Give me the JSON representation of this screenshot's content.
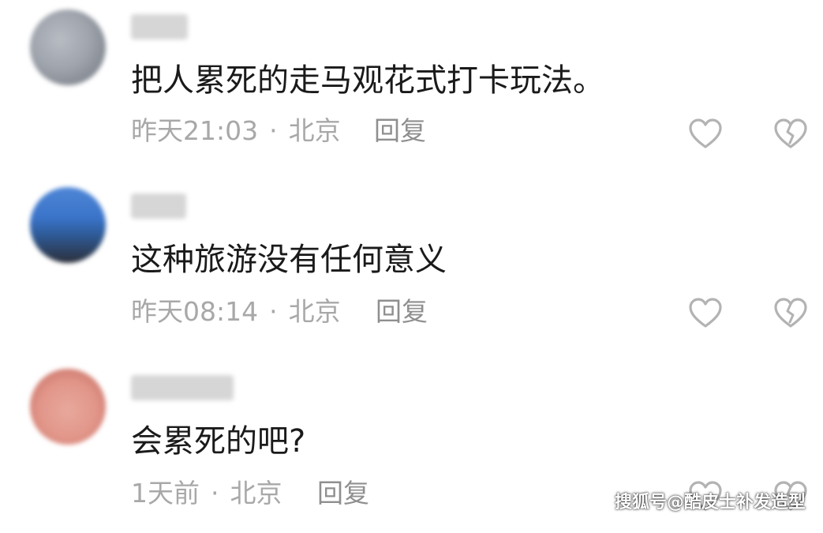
{
  "comments": [
    {
      "text": "把人累死的走马观花式打卡玩法。",
      "time": "昨天21:03",
      "separator": "·",
      "location": "北京",
      "reply_label": "回复",
      "avatar_colors": [
        "#9fa4ad",
        "#6e747c"
      ],
      "like_icon": "heart-outline-icon",
      "dislike_icon": "broken-heart-icon"
    },
    {
      "text": "这种旅游没有任何意义",
      "time": "昨天08:14",
      "separator": "·",
      "location": "北京",
      "reply_label": "回复",
      "avatar_colors": [
        "#3a74c9",
        "#2b2f3a"
      ],
      "like_icon": "heart-outline-icon",
      "dislike_icon": "broken-heart-icon"
    },
    {
      "text": "会累死的吧?",
      "time": "1天前",
      "separator": "·",
      "location": "北京",
      "reply_label": "回复",
      "avatar_colors": [
        "#e2968a",
        "#c0665a"
      ],
      "like_icon": "heart-outline-icon",
      "dislike_icon": "broken-heart-icon"
    }
  ],
  "watermark": "搜狐号@酷皮士补发造型",
  "colors": {
    "text": "#1a1a1a",
    "meta": "#a8a8a8",
    "icon": "#b3b3b3"
  }
}
